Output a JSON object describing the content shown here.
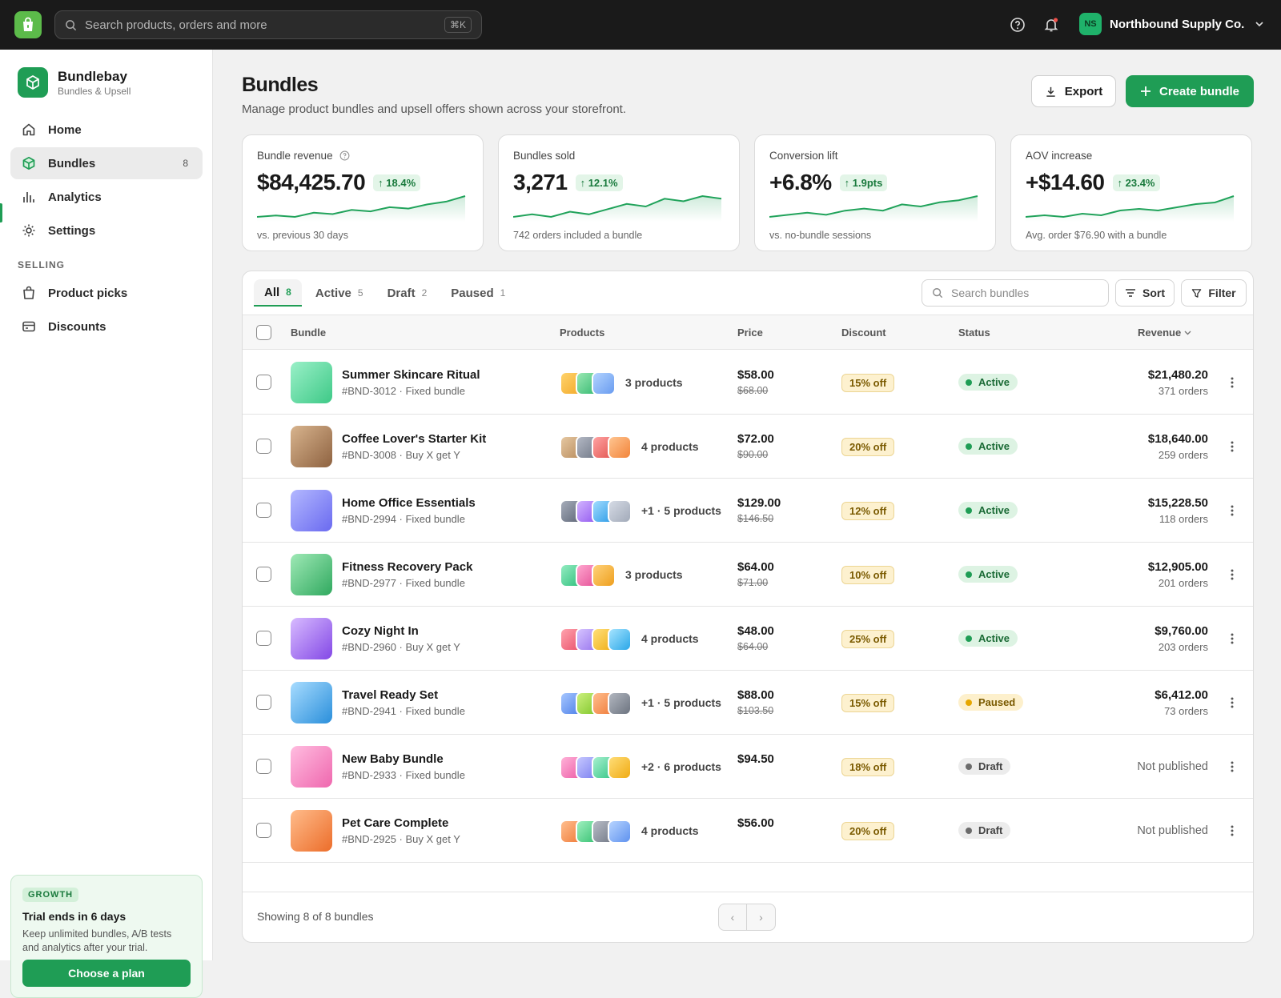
{
  "topbar": {
    "search_placeholder": "Search products, orders and more",
    "shortcut": "⌘K",
    "store_initials": "NS",
    "store_name": "Northbound Supply Co."
  },
  "sidebar": {
    "brand_name": "Bundlebay",
    "brand_sub": "Bundles & Upsell",
    "items": [
      {
        "label": "Home",
        "icon": "home-icon"
      },
      {
        "label": "Bundles",
        "icon": "box-icon",
        "badge": "8",
        "active": true
      },
      {
        "label": "Analytics",
        "icon": "bar-chart-icon"
      },
      {
        "label": "Settings",
        "icon": "gear-icon"
      }
    ],
    "section_label": "SELLING",
    "selling_items": [
      {
        "label": "Product picks",
        "icon": "shopping-bag-icon"
      },
      {
        "label": "Discounts",
        "icon": "card-icon"
      }
    ],
    "trial": {
      "tag": "GROWTH",
      "title": "Trial ends in 6 days",
      "text": "Keep unlimited bundles, A/B tests and analytics after your trial.",
      "button": "Choose a plan"
    }
  },
  "page": {
    "title": "Bundles",
    "subtitle": "Manage product bundles and upsell offers shown across your storefront.",
    "export_label": "Export",
    "create_label": "Create bundle"
  },
  "metrics": [
    {
      "label": "Bundle revenue",
      "value": "$84,425.70",
      "change": "18.4%",
      "footer": "vs. previous 30 days",
      "trend": [
        3,
        4,
        3,
        6,
        5,
        8,
        7,
        10,
        9,
        12,
        14,
        18
      ]
    },
    {
      "label": "Bundles sold",
      "value": "3,271",
      "change": "12.1%",
      "footer": "742 orders included a bundle",
      "trend": [
        4,
        5,
        4,
        6,
        5,
        7,
        9,
        8,
        11,
        10,
        12,
        11
      ]
    },
    {
      "label": "Conversion lift",
      "value": "+6.8%",
      "change": "1.9pts",
      "footer": "vs. no-bundle sessions",
      "trend": [
        3,
        4,
        5,
        4,
        6,
        7,
        6,
        9,
        8,
        10,
        11,
        13
      ]
    },
    {
      "label": "AOV increase",
      "value": "+$14.60",
      "change": "23.4%",
      "footer": "Avg. order $76.90 with a bundle",
      "trend": [
        3,
        4,
        3,
        5,
        4,
        7,
        8,
        7,
        9,
        11,
        12,
        16
      ]
    }
  ],
  "tabs": [
    {
      "label": "All",
      "count": "8",
      "active": true
    },
    {
      "label": "Active",
      "count": "5"
    },
    {
      "label": "Draft",
      "count": "2"
    },
    {
      "label": "Paused",
      "count": "1"
    }
  ],
  "toolbar": {
    "search_placeholder": "Search bundles",
    "sort": "Sort",
    "filter": "Filter"
  },
  "columns": {
    "bundle": "Bundle",
    "products": "Products",
    "price": "Price",
    "discount": "Discount",
    "status": "Status",
    "revenue": "Revenue"
  },
  "rows": [
    {
      "name": "Summer Skincare Ritual",
      "sub": "#BND-3012 · Fixed bundle",
      "thumb": [
        "#9af0c8",
        "#3ec987"
      ],
      "swatches": [
        [
          "#ffd36b",
          "#f2a92a"
        ],
        [
          "#9ae8b3",
          "#35b971"
        ],
        [
          "#b2d3ff",
          "#6a9cf0"
        ]
      ],
      "products": "3 products",
      "price": "$58.00",
      "original": "$68.00",
      "discount": "15% off",
      "status": "Active",
      "revenue": "$21,480.20",
      "orders": "371 orders"
    },
    {
      "name": "Coffee Lover's Starter Kit",
      "sub": "#BND-3008 · Buy X get Y",
      "thumb": [
        "#d8b48e",
        "#8e6240"
      ],
      "swatches": [
        [
          "#e5c7a1",
          "#b98d5e"
        ],
        [
          "#b3b8c4",
          "#707887"
        ],
        [
          "#ffa3a3",
          "#e2544f"
        ],
        [
          "#ffc591",
          "#f2843a"
        ]
      ],
      "products": "4 products",
      "price": "$72.00",
      "original": "$90.00",
      "discount": "20% off",
      "status": "Active",
      "revenue": "$18,640.00",
      "orders": "259 orders"
    },
    {
      "name": "Home Office Essentials",
      "sub": "#BND-2994 · Fixed bundle",
      "thumb": [
        "#b3b8ff",
        "#6a6af0"
      ],
      "swatches": [
        [
          "#a6adba",
          "#5e6677"
        ],
        [
          "#d2b4ff",
          "#9158ef"
        ],
        [
          "#a2dcff",
          "#2b9ae6"
        ],
        [
          "#d6dbe5",
          "#a2aab9"
        ]
      ],
      "products": "+1 · 5 products",
      "price": "$129.00",
      "original": "$146.50",
      "discount": "12% off",
      "status": "Active",
      "revenue": "$15,228.50",
      "orders": "118 orders"
    },
    {
      "name": "Fitness Recovery Pack",
      "sub": "#BND-2977 · Fixed bundle",
      "thumb": [
        "#9fe9b6",
        "#30a95f"
      ],
      "swatches": [
        [
          "#94ecc1",
          "#2fbf7d"
        ],
        [
          "#ffa7cf",
          "#e44f96"
        ],
        [
          "#ffd27a",
          "#ee9f1f"
        ]
      ],
      "products": "3 products",
      "price": "$64.00",
      "original": "$71.00",
      "discount": "10% off",
      "status": "Active",
      "revenue": "$12,905.00",
      "orders": "201 orders"
    },
    {
      "name": "Cozy Night In",
      "sub": "#BND-2960 · Buy X get Y",
      "thumb": [
        "#d8bbff",
        "#8348e6"
      ],
      "swatches": [
        [
          "#ffa3ad",
          "#e9506a"
        ],
        [
          "#d6c4ff",
          "#9774ee"
        ],
        [
          "#ffe07a",
          "#efad15"
        ],
        [
          "#a6e4ff",
          "#2ba7e8"
        ]
      ],
      "products": "4 products",
      "price": "$48.00",
      "original": "$64.00",
      "discount": "25% off",
      "status": "Active",
      "revenue": "$9,760.00",
      "orders": "203 orders"
    },
    {
      "name": "Travel Ready Set",
      "sub": "#BND-2941 · Fixed bundle",
      "thumb": [
        "#a8dcff",
        "#2a8fdb"
      ],
      "swatches": [
        [
          "#a7c7ff",
          "#4c7fe8"
        ],
        [
          "#ccf07e",
          "#7fc62a"
        ],
        [
          "#ffbe8e",
          "#ef7b39"
        ],
        [
          "#b2b7c0",
          "#6d7480"
        ]
      ],
      "products": "+1 · 5 products",
      "price": "$88.00",
      "original": "$103.50",
      "discount": "15% off",
      "status": "Paused",
      "revenue": "$6,412.00",
      "orders": "73 orders"
    },
    {
      "name": "New Baby Bundle",
      "sub": "#BND-2933 · Fixed bundle",
      "thumb": [
        "#ffbde0",
        "#ef67ae"
      ],
      "swatches": [
        [
          "#ffb2d8",
          "#ec5ca6"
        ],
        [
          "#c6c8ff",
          "#7a7ef0"
        ],
        [
          "#a7f0cf",
          "#35c585"
        ],
        [
          "#ffdd77",
          "#f0ab14"
        ]
      ],
      "products": "+2 · 6 products",
      "price": "$94.50",
      "original": "",
      "discount": "18% off",
      "status": "Draft",
      "revenue": "Not published",
      "orders": ""
    },
    {
      "name": "Pet Care Complete",
      "sub": "#BND-2925 · Buy X get Y",
      "thumb": [
        "#ffbc8b",
        "#ec6d2a"
      ],
      "swatches": [
        [
          "#ffbe8e",
          "#ef7b39"
        ],
        [
          "#9ff0bf",
          "#36c071"
        ],
        [
          "#b8bcc6",
          "#727987"
        ],
        [
          "#b7d4ff",
          "#5f92ef"
        ]
      ],
      "products": "4 products",
      "price": "$56.00",
      "original": "",
      "discount": "20% off",
      "status": "Draft",
      "revenue": "Not published",
      "orders": ""
    }
  ],
  "footer": {
    "showing": "Showing 8 of 8 bundles",
    "prev": "‹",
    "next": "›"
  },
  "colors": {
    "accent": "#1f9d55",
    "topbar": "#1a1a1a",
    "sparkline": "#21a35b"
  }
}
